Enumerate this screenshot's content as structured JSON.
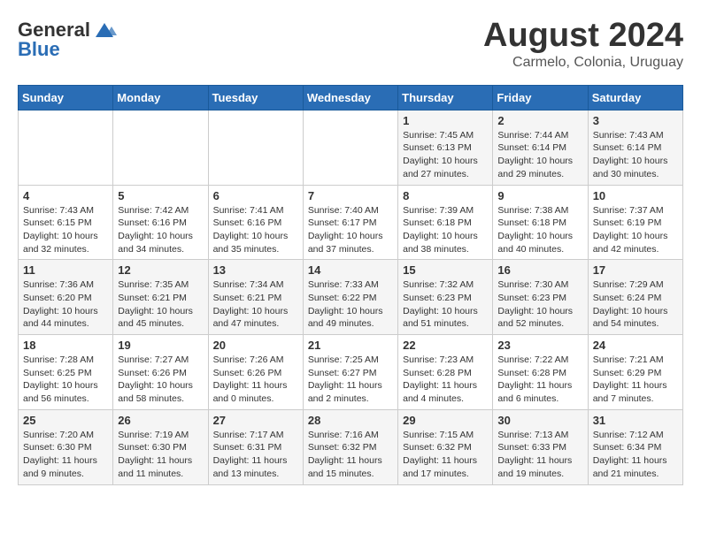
{
  "header": {
    "logo_line1": "General",
    "logo_line2": "Blue",
    "month_title": "August 2024",
    "location": "Carmelo, Colonia, Uruguay"
  },
  "weekdays": [
    "Sunday",
    "Monday",
    "Tuesday",
    "Wednesday",
    "Thursday",
    "Friday",
    "Saturday"
  ],
  "weeks": [
    [
      {
        "day": "",
        "info": ""
      },
      {
        "day": "",
        "info": ""
      },
      {
        "day": "",
        "info": ""
      },
      {
        "day": "",
        "info": ""
      },
      {
        "day": "1",
        "info": "Sunrise: 7:45 AM\nSunset: 6:13 PM\nDaylight: 10 hours\nand 27 minutes."
      },
      {
        "day": "2",
        "info": "Sunrise: 7:44 AM\nSunset: 6:14 PM\nDaylight: 10 hours\nand 29 minutes."
      },
      {
        "day": "3",
        "info": "Sunrise: 7:43 AM\nSunset: 6:14 PM\nDaylight: 10 hours\nand 30 minutes."
      }
    ],
    [
      {
        "day": "4",
        "info": "Sunrise: 7:43 AM\nSunset: 6:15 PM\nDaylight: 10 hours\nand 32 minutes."
      },
      {
        "day": "5",
        "info": "Sunrise: 7:42 AM\nSunset: 6:16 PM\nDaylight: 10 hours\nand 34 minutes."
      },
      {
        "day": "6",
        "info": "Sunrise: 7:41 AM\nSunset: 6:16 PM\nDaylight: 10 hours\nand 35 minutes."
      },
      {
        "day": "7",
        "info": "Sunrise: 7:40 AM\nSunset: 6:17 PM\nDaylight: 10 hours\nand 37 minutes."
      },
      {
        "day": "8",
        "info": "Sunrise: 7:39 AM\nSunset: 6:18 PM\nDaylight: 10 hours\nand 38 minutes."
      },
      {
        "day": "9",
        "info": "Sunrise: 7:38 AM\nSunset: 6:18 PM\nDaylight: 10 hours\nand 40 minutes."
      },
      {
        "day": "10",
        "info": "Sunrise: 7:37 AM\nSunset: 6:19 PM\nDaylight: 10 hours\nand 42 minutes."
      }
    ],
    [
      {
        "day": "11",
        "info": "Sunrise: 7:36 AM\nSunset: 6:20 PM\nDaylight: 10 hours\nand 44 minutes."
      },
      {
        "day": "12",
        "info": "Sunrise: 7:35 AM\nSunset: 6:21 PM\nDaylight: 10 hours\nand 45 minutes."
      },
      {
        "day": "13",
        "info": "Sunrise: 7:34 AM\nSunset: 6:21 PM\nDaylight: 10 hours\nand 47 minutes."
      },
      {
        "day": "14",
        "info": "Sunrise: 7:33 AM\nSunset: 6:22 PM\nDaylight: 10 hours\nand 49 minutes."
      },
      {
        "day": "15",
        "info": "Sunrise: 7:32 AM\nSunset: 6:23 PM\nDaylight: 10 hours\nand 51 minutes."
      },
      {
        "day": "16",
        "info": "Sunrise: 7:30 AM\nSunset: 6:23 PM\nDaylight: 10 hours\nand 52 minutes."
      },
      {
        "day": "17",
        "info": "Sunrise: 7:29 AM\nSunset: 6:24 PM\nDaylight: 10 hours\nand 54 minutes."
      }
    ],
    [
      {
        "day": "18",
        "info": "Sunrise: 7:28 AM\nSunset: 6:25 PM\nDaylight: 10 hours\nand 56 minutes."
      },
      {
        "day": "19",
        "info": "Sunrise: 7:27 AM\nSunset: 6:26 PM\nDaylight: 10 hours\nand 58 minutes."
      },
      {
        "day": "20",
        "info": "Sunrise: 7:26 AM\nSunset: 6:26 PM\nDaylight: 11 hours\nand 0 minutes."
      },
      {
        "day": "21",
        "info": "Sunrise: 7:25 AM\nSunset: 6:27 PM\nDaylight: 11 hours\nand 2 minutes."
      },
      {
        "day": "22",
        "info": "Sunrise: 7:23 AM\nSunset: 6:28 PM\nDaylight: 11 hours\nand 4 minutes."
      },
      {
        "day": "23",
        "info": "Sunrise: 7:22 AM\nSunset: 6:28 PM\nDaylight: 11 hours\nand 6 minutes."
      },
      {
        "day": "24",
        "info": "Sunrise: 7:21 AM\nSunset: 6:29 PM\nDaylight: 11 hours\nand 7 minutes."
      }
    ],
    [
      {
        "day": "25",
        "info": "Sunrise: 7:20 AM\nSunset: 6:30 PM\nDaylight: 11 hours\nand 9 minutes."
      },
      {
        "day": "26",
        "info": "Sunrise: 7:19 AM\nSunset: 6:30 PM\nDaylight: 11 hours\nand 11 minutes."
      },
      {
        "day": "27",
        "info": "Sunrise: 7:17 AM\nSunset: 6:31 PM\nDaylight: 11 hours\nand 13 minutes."
      },
      {
        "day": "28",
        "info": "Sunrise: 7:16 AM\nSunset: 6:32 PM\nDaylight: 11 hours\nand 15 minutes."
      },
      {
        "day": "29",
        "info": "Sunrise: 7:15 AM\nSunset: 6:32 PM\nDaylight: 11 hours\nand 17 minutes."
      },
      {
        "day": "30",
        "info": "Sunrise: 7:13 AM\nSunset: 6:33 PM\nDaylight: 11 hours\nand 19 minutes."
      },
      {
        "day": "31",
        "info": "Sunrise: 7:12 AM\nSunset: 6:34 PM\nDaylight: 11 hours\nand 21 minutes."
      }
    ]
  ]
}
